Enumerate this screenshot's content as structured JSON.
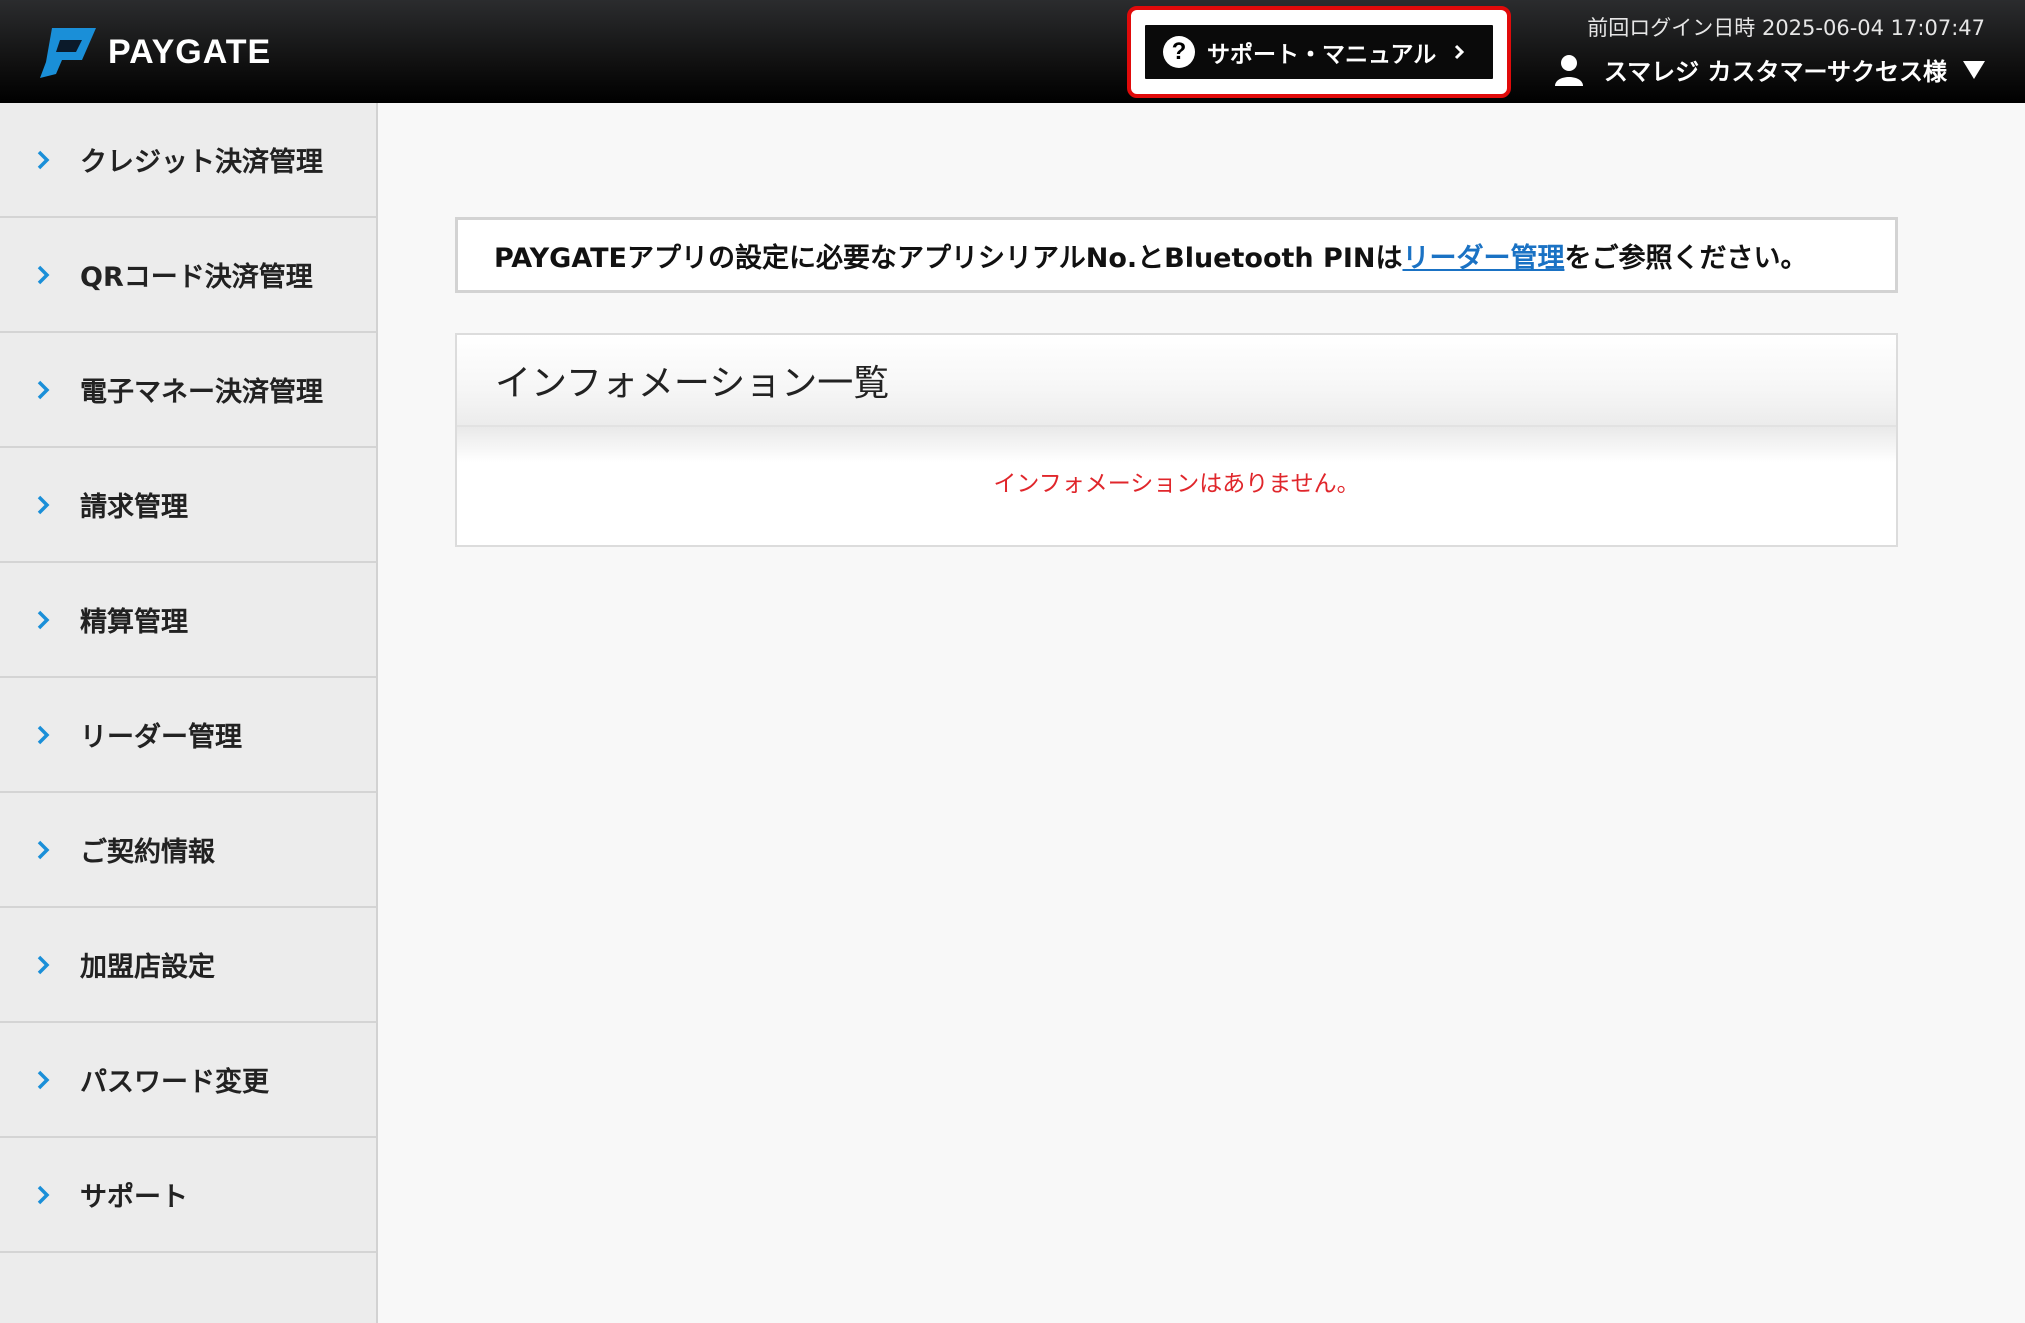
{
  "header": {
    "logo_text": "PAYGATE",
    "support_button": "サポート・マニュアル",
    "last_login": "前回ログイン日時 2025-06-04 17:07:47",
    "user_name": "スマレジ カスタマーサクセス様"
  },
  "sidebar": {
    "items": [
      {
        "label": "クレジット決済管理"
      },
      {
        "label": "QRコード決済管理"
      },
      {
        "label": "電子マネー決済管理"
      },
      {
        "label": "請求管理"
      },
      {
        "label": "精算管理"
      },
      {
        "label": "リーダー管理"
      },
      {
        "label": "ご契約情報"
      },
      {
        "label": "加盟店設定"
      },
      {
        "label": "パスワード変更"
      },
      {
        "label": "サポート"
      }
    ]
  },
  "notice": {
    "before": "PAYGATEアプリの設定に必要なアプリシリアルNo.とBluetooth PINは",
    "link": "リーダー管理",
    "after": "をご参照ください。"
  },
  "info_panel": {
    "title": "インフォメーション一覧",
    "empty_message": "インフォメーションはありません。"
  },
  "colors": {
    "accent_blue": "#1a8fd8",
    "link": "#1a72c4",
    "highlight_red": "#e10a0a",
    "empty_text": "#e0262b"
  }
}
